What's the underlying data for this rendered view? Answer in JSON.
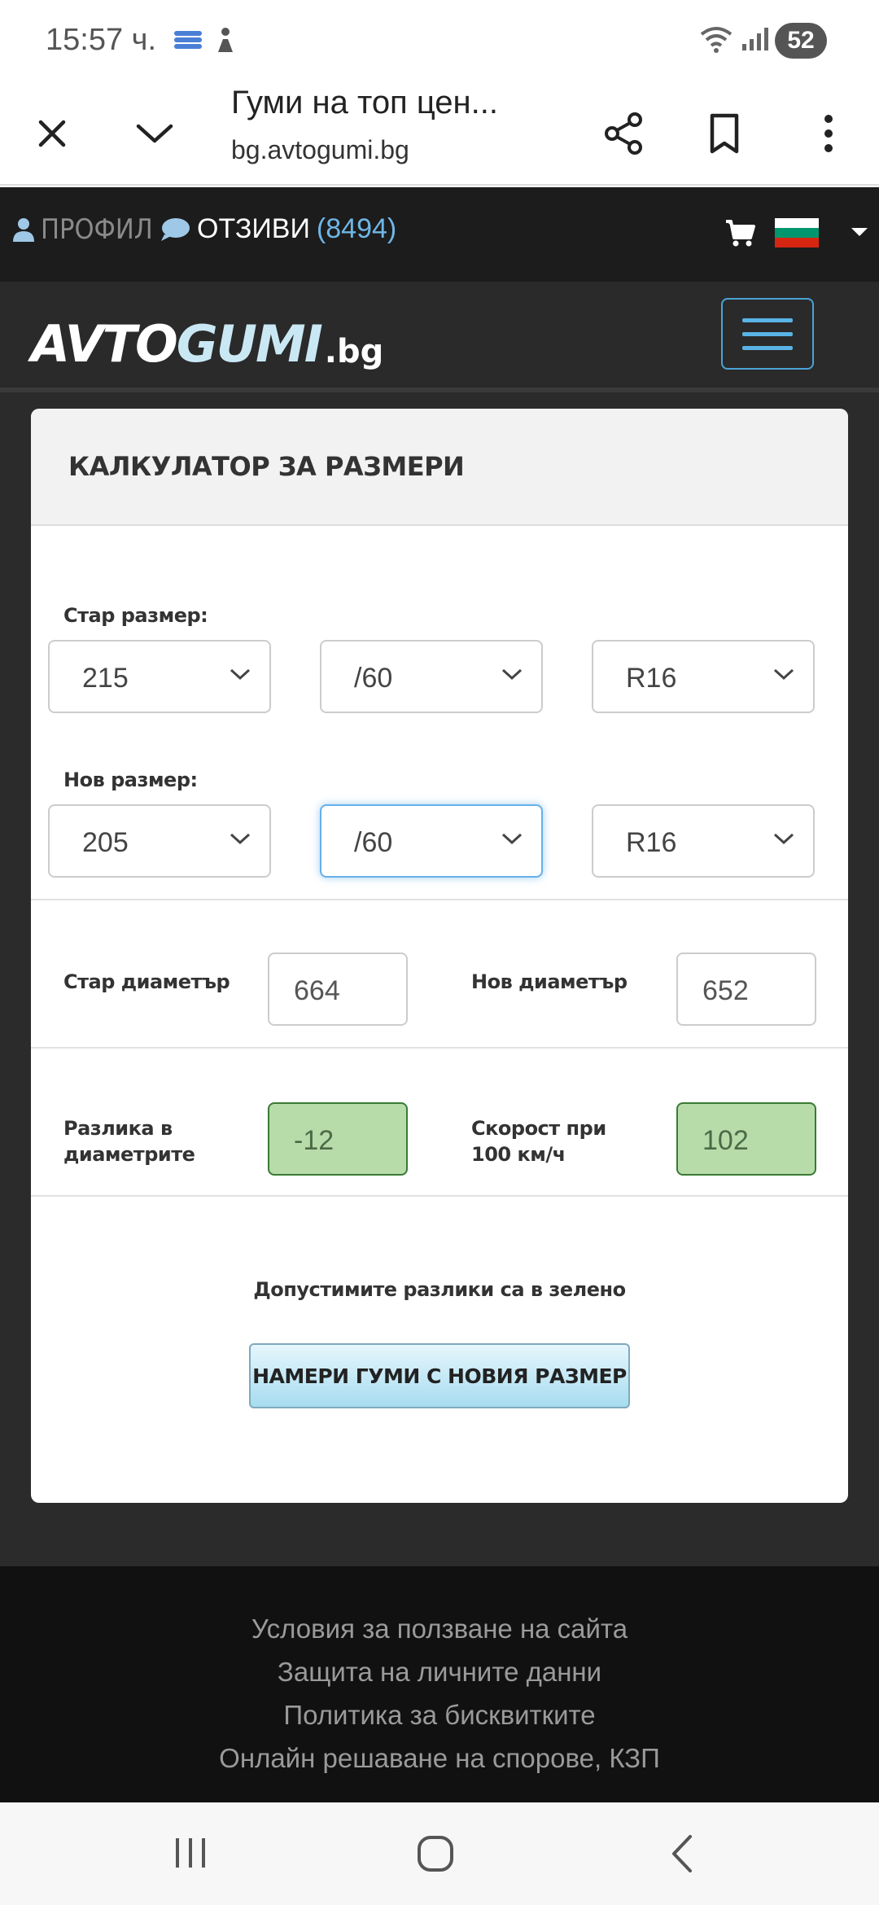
{
  "status_bar": {
    "time": "15:57 ч.",
    "battery": "52",
    "icons": [
      "notification-app-icon",
      "accessibility-icon",
      "wifi-icon",
      "signal-icon",
      "battery-icon"
    ]
  },
  "browser": {
    "page_title": "Гуми на топ цен...",
    "url": "bg.avtogumi.bg",
    "icons": [
      "close-icon",
      "chevron-down-icon",
      "share-icon",
      "bookmark-icon",
      "more-vertical-icon"
    ]
  },
  "site_bar": {
    "profile_label": "ПРОФИЛ",
    "reviews_label": "ОТЗИВИ",
    "reviews_count": "(8494)",
    "flag_colors": [
      "#ffffff",
      "#00966e",
      "#d62612"
    ]
  },
  "logo": {
    "part1": "AVTO",
    "part2": "GUMI",
    "suffix": ".bg"
  },
  "calculator": {
    "title": "КАЛКУЛАТОР ЗА РАЗМЕРИ",
    "old_size_label": "Стар размер:",
    "old_size": {
      "width": "215",
      "profile": "/60",
      "rim": "R16"
    },
    "new_size_label": "Нов размер:",
    "new_size": {
      "width": "205",
      "profile": "/60",
      "rim": "R16"
    },
    "old_diameter_label": "Стар диаметър",
    "old_diameter": "664",
    "new_diameter_label": "Нов диаметър",
    "new_diameter": "652",
    "diff_label_line1": "Разлика в",
    "diff_label_line2": "диаметрите",
    "diff_value": "-12",
    "speed_label_line1": "Скорост при",
    "speed_label_line2": "100 км/ч",
    "speed_value": "102",
    "note": "Допустимите разлики са в зелено",
    "button_label": "НАМЕРИ ГУМИ С НОВИЯ РАЗМЕР",
    "accent_green": "#b7dcaa",
    "accent_blue": "#66afe9"
  },
  "footer": {
    "links": [
      "Условия за ползване на сайта",
      "Защита на личните данни",
      "Политика за бисквитките",
      "Онлайн решаване на спорове, КЗП"
    ]
  },
  "nav_bar": {
    "icons": [
      "recent-apps-icon",
      "home-icon",
      "back-icon"
    ]
  }
}
